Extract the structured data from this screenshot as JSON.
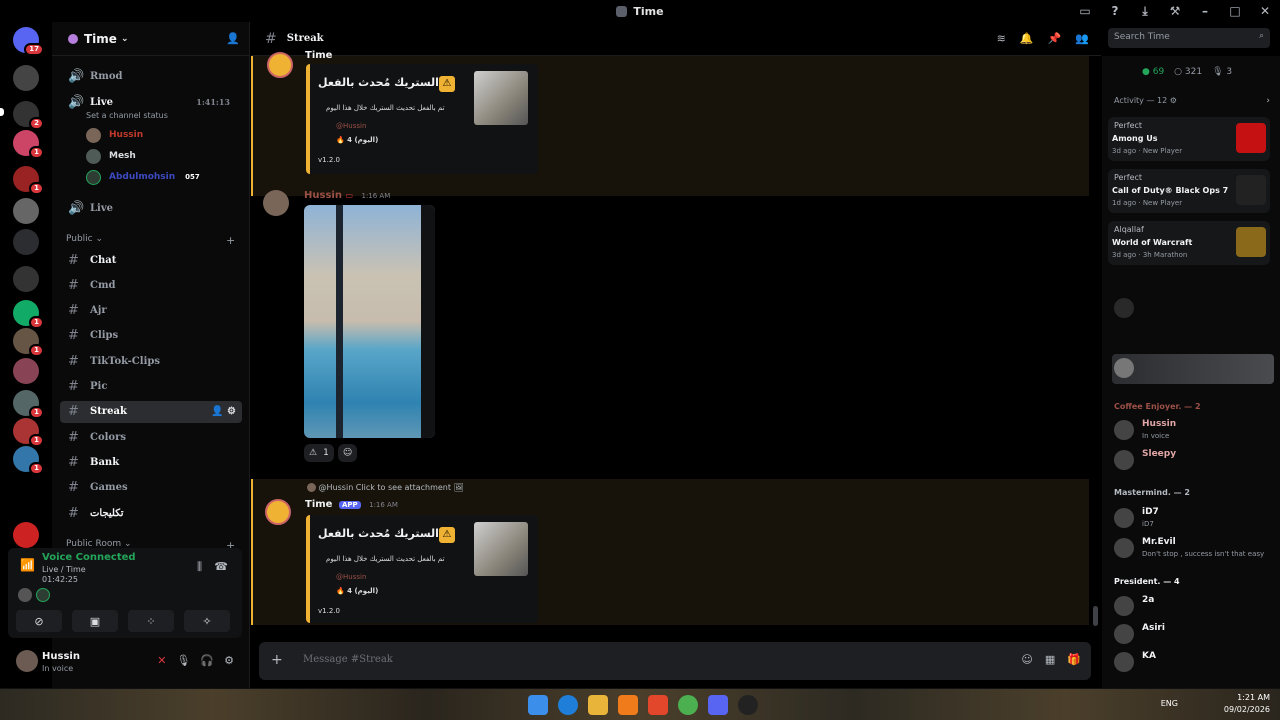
{
  "window": {
    "title": "Time"
  },
  "rail": {
    "servers": [
      {
        "name": "discord-home",
        "badge": "17",
        "color": "#5865f2"
      },
      {
        "name": "server-1",
        "badge": "",
        "color": "#444"
      },
      {
        "name": "server-2",
        "badge": "2",
        "color": "#333"
      },
      {
        "name": "server-3",
        "badge": "1",
        "color": "#c46"
      },
      {
        "name": "server-4",
        "badge": "1",
        "color": "#922"
      },
      {
        "name": "server-5",
        "badge": "",
        "color": "#666"
      },
      {
        "name": "server-6",
        "badge": "",
        "color": "#2b2d31"
      },
      {
        "name": "server-7",
        "badge": "",
        "color": "#333"
      },
      {
        "name": "server-8",
        "badge": "1",
        "color": "#1a6"
      },
      {
        "name": "server-9",
        "badge": "1",
        "color": "#654"
      },
      {
        "name": "server-10",
        "badge": "",
        "color": "#845"
      },
      {
        "name": "server-11",
        "badge": "1",
        "color": "#566"
      },
      {
        "name": "server-12",
        "badge": "1",
        "color": "#a33"
      },
      {
        "name": "server-13",
        "badge": "1",
        "color": "#37a"
      },
      {
        "name": "server-14",
        "badge": "",
        "color": "#c22"
      }
    ]
  },
  "sidebar": {
    "guild_name": "Time",
    "voice_channels": [
      {
        "name": "Rmod"
      },
      {
        "name": "Live",
        "timer": "1:41:13",
        "status": "Set a channel status"
      },
      {
        "name": "Live"
      }
    ],
    "voice_users": [
      {
        "name": "Hussin",
        "color": "#c0392b"
      },
      {
        "name": "Mesh",
        "color": "#dbdee1"
      },
      {
        "name": "Abdulmohsin",
        "color": "#5865f2",
        "tag": "057"
      }
    ],
    "category_public": "Public",
    "category_public_room": "Public Room",
    "channels": [
      {
        "name": "Chat",
        "bright": true
      },
      {
        "name": "Cmd"
      },
      {
        "name": "Ajr"
      },
      {
        "name": "Clips"
      },
      {
        "name": "TikTok-Clips"
      },
      {
        "name": "Pic"
      },
      {
        "name": "Streak",
        "active": true
      },
      {
        "name": "Colors"
      },
      {
        "name": "Bank",
        "bright": true
      },
      {
        "name": "Games"
      },
      {
        "name": "تكليجات",
        "bright": true
      }
    ]
  },
  "voice_panel": {
    "status": "Voice Connected",
    "channel": "Live / Time",
    "timer": "01:42:25"
  },
  "user_panel": {
    "name": "Hussin",
    "status": "In voice"
  },
  "header": {
    "channel": "Streak",
    "search_placeholder": "Search Time"
  },
  "messages": {
    "embed": {
      "title": "الستريك مُحدث بالفعل",
      "desc": "تم بالفعل تحديث الستريك خلال هذا اليوم",
      "mention": "@Hussin",
      "streak": "4 (اليوم)",
      "version": "v1.2.0"
    },
    "first_author": "Time",
    "photo_msg": {
      "author": "Hussin",
      "time": "1:16 AM",
      "reaction_count": "1"
    },
    "reply_text": "@Hussin Click to see attachment",
    "bot_msg": {
      "author": "Time",
      "badge": "APP",
      "time": "1:16 AM"
    }
  },
  "composer": {
    "placeholder": "Message #Streak"
  },
  "members": {
    "online": "69",
    "total": "321",
    "voice": "3",
    "activity_head": "Activity — 12",
    "activities": [
      {
        "who": "Perfect",
        "game": "Among Us",
        "meta": "3d ago · New Player",
        "color": "#c51111"
      },
      {
        "who": "Perfect",
        "game": "Call of Duty® Black Ops 7",
        "meta": "1d ago · New Player",
        "color": "#222"
      },
      {
        "who": "Alqallaf",
        "game": "World of Warcraft",
        "meta": "3d ago · 3h Marathon",
        "color": "#8a6a1a"
      }
    ],
    "roles": [
      {
        "name": "Coffee Enjoyer. — 2",
        "color": "#9b5046"
      },
      {
        "name": "Mastermind. — 2",
        "color": "#b5bac1"
      },
      {
        "name": "President. — 4",
        "color": "#f2f3f5"
      }
    ],
    "list": [
      {
        "name": "Hussin",
        "sub": "In voice",
        "color": "#e0a5a5"
      },
      {
        "name": "Sleepy",
        "sub": "",
        "color": "#e0a5a5"
      },
      {
        "name": "iD7",
        "sub": "iD7",
        "color": "#f2f3f5"
      },
      {
        "name": "Mr.Evil",
        "sub": "Don't stop , success isn't that easy",
        "color": "#f2f3f5"
      },
      {
        "name": "2a",
        "sub": "",
        "color": "#f2f3f5"
      },
      {
        "name": "Asiri",
        "sub": "",
        "color": "#f2f3f5"
      },
      {
        "name": "KA",
        "sub": "",
        "color": "#f2f3f5"
      }
    ]
  },
  "taskbar": {
    "time": "1:21 AM",
    "date": "09/02/2026",
    "lang": "ENG"
  }
}
